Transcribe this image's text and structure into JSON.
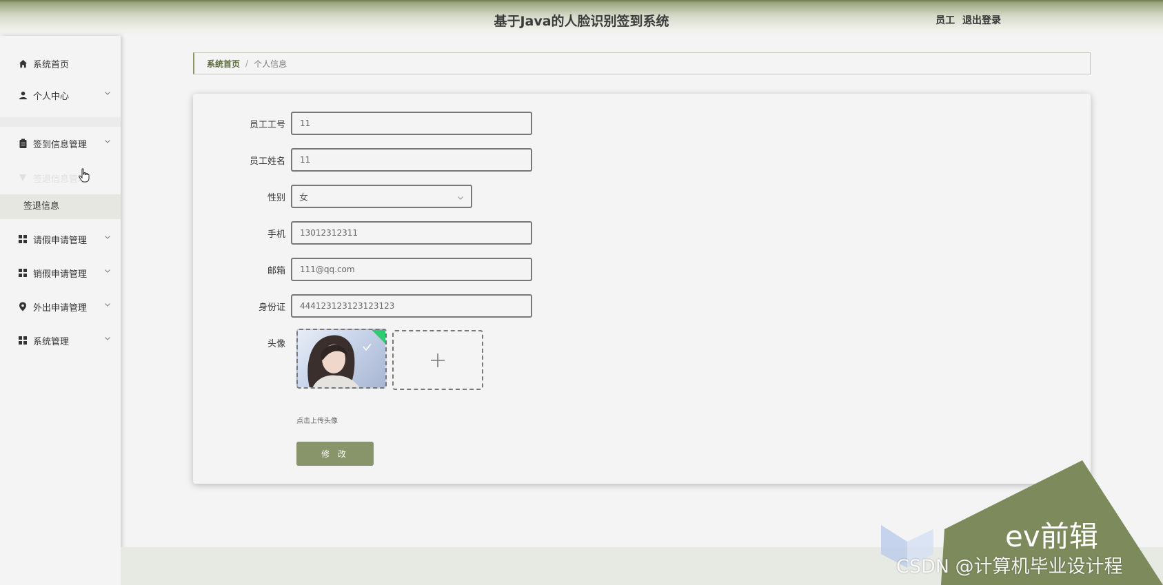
{
  "header": {
    "title": "基于Java的人脸识别签到系统",
    "role": "员工",
    "logout": "退出登录"
  },
  "sidebar": {
    "items": [
      {
        "label": "系统首页",
        "icon": "home-icon"
      },
      {
        "label": "个人中心",
        "icon": "user-icon"
      },
      {
        "label": "签到信息管理",
        "icon": "clipboard-icon"
      },
      {
        "label": "签退信息管理",
        "icon": "shield-icon"
      },
      {
        "label": "请假申请管理",
        "icon": "grid-icon"
      },
      {
        "label": "销假申请管理",
        "icon": "grid-icon"
      },
      {
        "label": "外出申请管理",
        "icon": "location-icon"
      },
      {
        "label": "系统管理",
        "icon": "grid-icon"
      }
    ],
    "submenu_item": "签退信息"
  },
  "breadcrumb": {
    "home": "系统首页",
    "separator": "/",
    "current": "个人信息"
  },
  "form": {
    "fields": [
      {
        "label": "员工工号",
        "value": "11"
      },
      {
        "label": "员工姓名",
        "value": "11"
      },
      {
        "label": "性别",
        "value": "女"
      },
      {
        "label": "手机",
        "value": "13012312311"
      },
      {
        "label": "邮箱",
        "value": "111@qq.com"
      },
      {
        "label": "身份证",
        "value": "444123123123123123"
      }
    ],
    "avatar_label": "头像",
    "upload_hint": "点击上传头像",
    "submit_label": "修 改"
  },
  "watermark": {
    "brand": "ev前辑",
    "credit": "CSDN @计算机毕业设计程"
  },
  "colors": {
    "accent": "#88956a",
    "header": "#6e7a52",
    "success": "#2ecc71"
  }
}
